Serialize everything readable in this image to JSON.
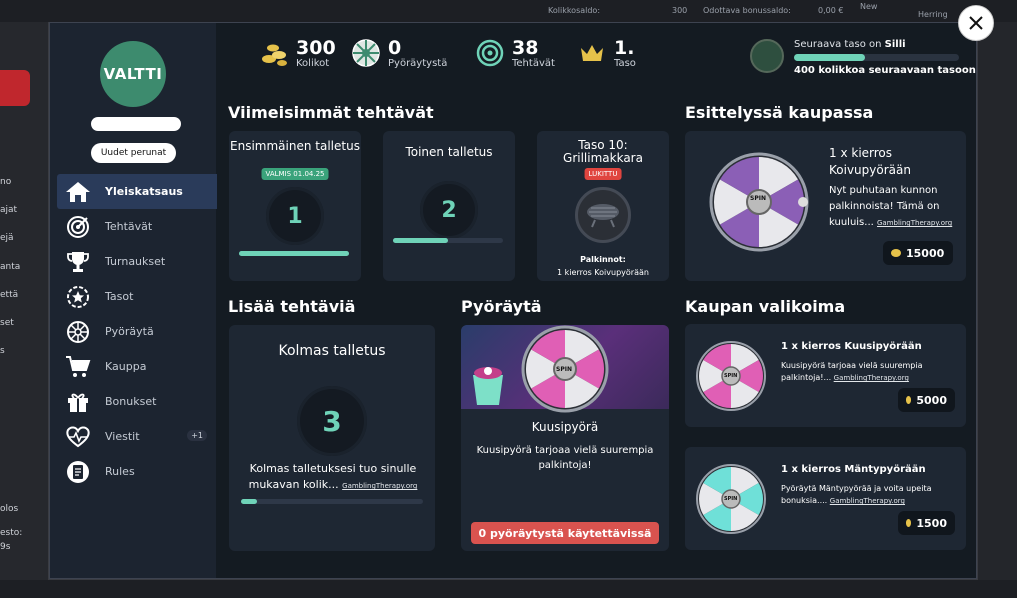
{
  "background": {
    "top_left_text": "Kolikkosaldo:",
    "top_value1": "300",
    "top_mid_text": "Odottava bonussaldo:",
    "top_value2": "0,00 €",
    "top_new": "New",
    "top_search": "Herring",
    "left_fragments": [
      "no",
      "ajat",
      "ejä",
      "anta",
      "että",
      "set",
      "s",
      "olos",
      "esto:",
      "9s"
    ]
  },
  "sidebar": {
    "logo": "VALTTI",
    "news_button": "Uudet perunat",
    "items": [
      {
        "label": "Yleiskatsaus",
        "icon": "home-icon"
      },
      {
        "label": "Tehtävät",
        "icon": "target-icon"
      },
      {
        "label": "Turnaukset",
        "icon": "trophy-icon"
      },
      {
        "label": "Tasot",
        "icon": "star-badge-icon"
      },
      {
        "label": "Pyöräytä",
        "icon": "wheel-icon"
      },
      {
        "label": "Kauppa",
        "icon": "cart-icon"
      },
      {
        "label": "Bonukset",
        "icon": "gift-icon"
      },
      {
        "label": "Viestit",
        "icon": "heartbeat-icon",
        "badge": "+1"
      },
      {
        "label": "Rules",
        "icon": "document-icon"
      }
    ]
  },
  "stats": {
    "coins": {
      "value": "300",
      "label": "Kolikot"
    },
    "spins": {
      "value": "0",
      "label": "Pyöräytystä"
    },
    "tasks": {
      "value": "38",
      "label": "Tehtävät"
    },
    "level": {
      "value": "1.",
      "label": "Taso"
    }
  },
  "next_level": {
    "title_prefix": "Seuraava taso on",
    "title_name": "Silli",
    "subtitle": "400 kolikkoa seuraavaan tasoon",
    "progress": 0.43
  },
  "recent_tasks": {
    "title": "Viimeisimmät tehtävät",
    "cards": [
      {
        "title": "Ensimmäinen talletus",
        "badge": "VALMIS 01.04.25",
        "number": "1",
        "progress": 1.0
      },
      {
        "title": "Toinen talletus",
        "number": "2",
        "progress": 0.5
      },
      {
        "title": "Taso 10: Grillimakkara",
        "badge": "LUKITTU",
        "prizes_label": "Palkinnot:",
        "prizes_value": "1 kierros Koivupyörään"
      }
    ]
  },
  "featured": {
    "title": "Esittelyssä kaupassa",
    "item_title": "1 x kierros Koivupyörään",
    "desc": "Nyt puhutaan kunnon palkinnoista! Tämä on kuuluis...",
    "link": "GamblingTherapy.org",
    "price": "15000",
    "wheel_label": "SPIN"
  },
  "more_tasks": {
    "title": "Lisää tehtäviä",
    "card_title": "Kolmas talletus",
    "number": "3",
    "desc": "Kolmas talletuksesi tuo sinulle mukavan kolik...",
    "link": "GamblingTherapy.org",
    "progress": 0.09
  },
  "spin": {
    "title": "Pyöräytä",
    "wheel_name": "Kuusipyörä",
    "desc": "Kuusipyörä tarjoaa vielä suurempia palkintoja!",
    "button": "0 pyöräytystä käytettävissä",
    "wheel_label": "SPIN"
  },
  "shop": {
    "title": "Kaupan valikoima",
    "items": [
      {
        "title": "1 x kierros Kuusipyörään",
        "desc": "Kuusipyörä tarjoaa vielä suurempia palkintoja!...",
        "link": "GamblingTherapy.org",
        "price": "5000",
        "wheel_label": "SPIN"
      },
      {
        "title": "1 x kierros Mäntypyörään",
        "desc": "Pyöräytä Mäntypyörää ja voita upeita bonuksia....",
        "link": "GamblingTherapy.org",
        "price": "1500",
        "wheel_label": "SPIN"
      }
    ]
  },
  "colors": {
    "accent": "#6fd3b8",
    "card": "#1e2733",
    "badge_done": "#3aa37b",
    "badge_locked": "#e0453f",
    "button_red": "#d9534f"
  }
}
